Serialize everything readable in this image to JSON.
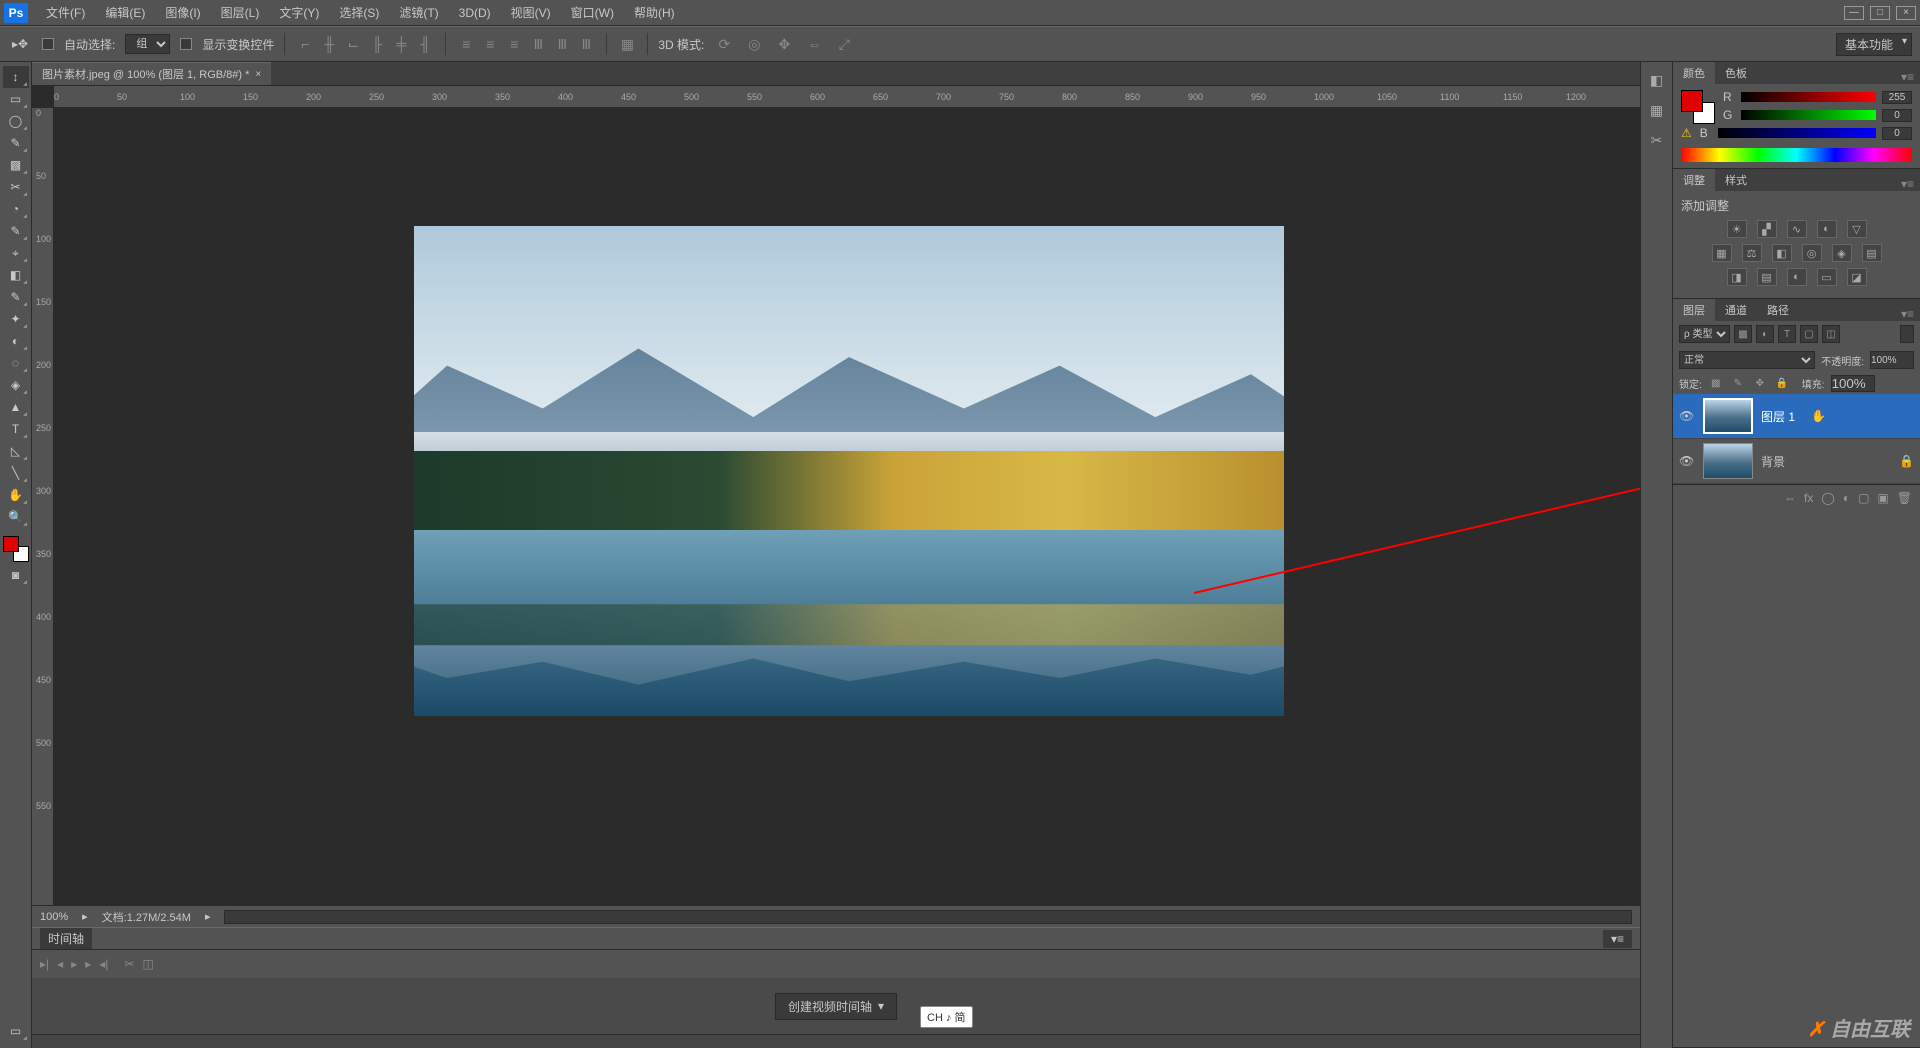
{
  "app_icon": "Ps",
  "menu": [
    "文件(F)",
    "编辑(E)",
    "图像(I)",
    "图层(L)",
    "文字(Y)",
    "选择(S)",
    "滤镜(T)",
    "3D(D)",
    "视图(V)",
    "窗口(W)",
    "帮助(H)"
  ],
  "options": {
    "auto_select": "自动选择:",
    "group": "组",
    "show_transform": "显示变换控件",
    "mode3d": "3D 模式:"
  },
  "workspace": "基本功能",
  "document": {
    "tab_title": "图片素材.jpeg @ 100% (图层 1, RGB/8#) *",
    "zoom": "100%",
    "doc_info": "文档:1.27M/2.54M"
  },
  "ruler_h": [
    0,
    50,
    100,
    150,
    200,
    250,
    300,
    350,
    400,
    450,
    500,
    550,
    600,
    650,
    700,
    750,
    800,
    850,
    900,
    950,
    1000,
    1050,
    1100,
    1150,
    1200
  ],
  "ruler_v": [
    0,
    50,
    100,
    150,
    200,
    250,
    300,
    350,
    400,
    450,
    500,
    550
  ],
  "timeline": {
    "tab": "时间轴",
    "create": "创建视频时间轴"
  },
  "ime": "CH ♪ 简",
  "color_panel": {
    "tabs": [
      "颜色",
      "色板"
    ],
    "channels": [
      {
        "label": "R",
        "value": 255,
        "grad": "r-grad"
      },
      {
        "label": "G",
        "value": 0,
        "grad": "g-grad"
      },
      {
        "label": "B",
        "value": 0,
        "grad": "b-grad"
      }
    ],
    "warn": "⚠"
  },
  "adjustments_panel": {
    "tabs": [
      "调整",
      "样式"
    ],
    "title": "添加调整"
  },
  "layers_panel": {
    "tabs": [
      "图层",
      "通道",
      "路径"
    ],
    "filter_label": "ρ 类型",
    "blend": "正常",
    "opacity_label": "不透明度:",
    "opacity": "100%",
    "lock_label": "锁定:",
    "fill_label": "填充:",
    "fill": "100%",
    "layers": [
      {
        "name": "图层 1",
        "selected": true,
        "locked": false
      },
      {
        "name": "背景",
        "selected": false,
        "locked": true
      }
    ]
  },
  "tools": [
    "↕",
    "▭",
    "◯",
    "✎",
    "▩",
    "✂",
    "◔",
    "✎",
    "⌖",
    "◧",
    "✎",
    "✦",
    "◐",
    "◌",
    "◈",
    "▲",
    "T",
    "◺",
    "╲",
    "✋",
    "🔍"
  ],
  "watermark": "自由互联"
}
